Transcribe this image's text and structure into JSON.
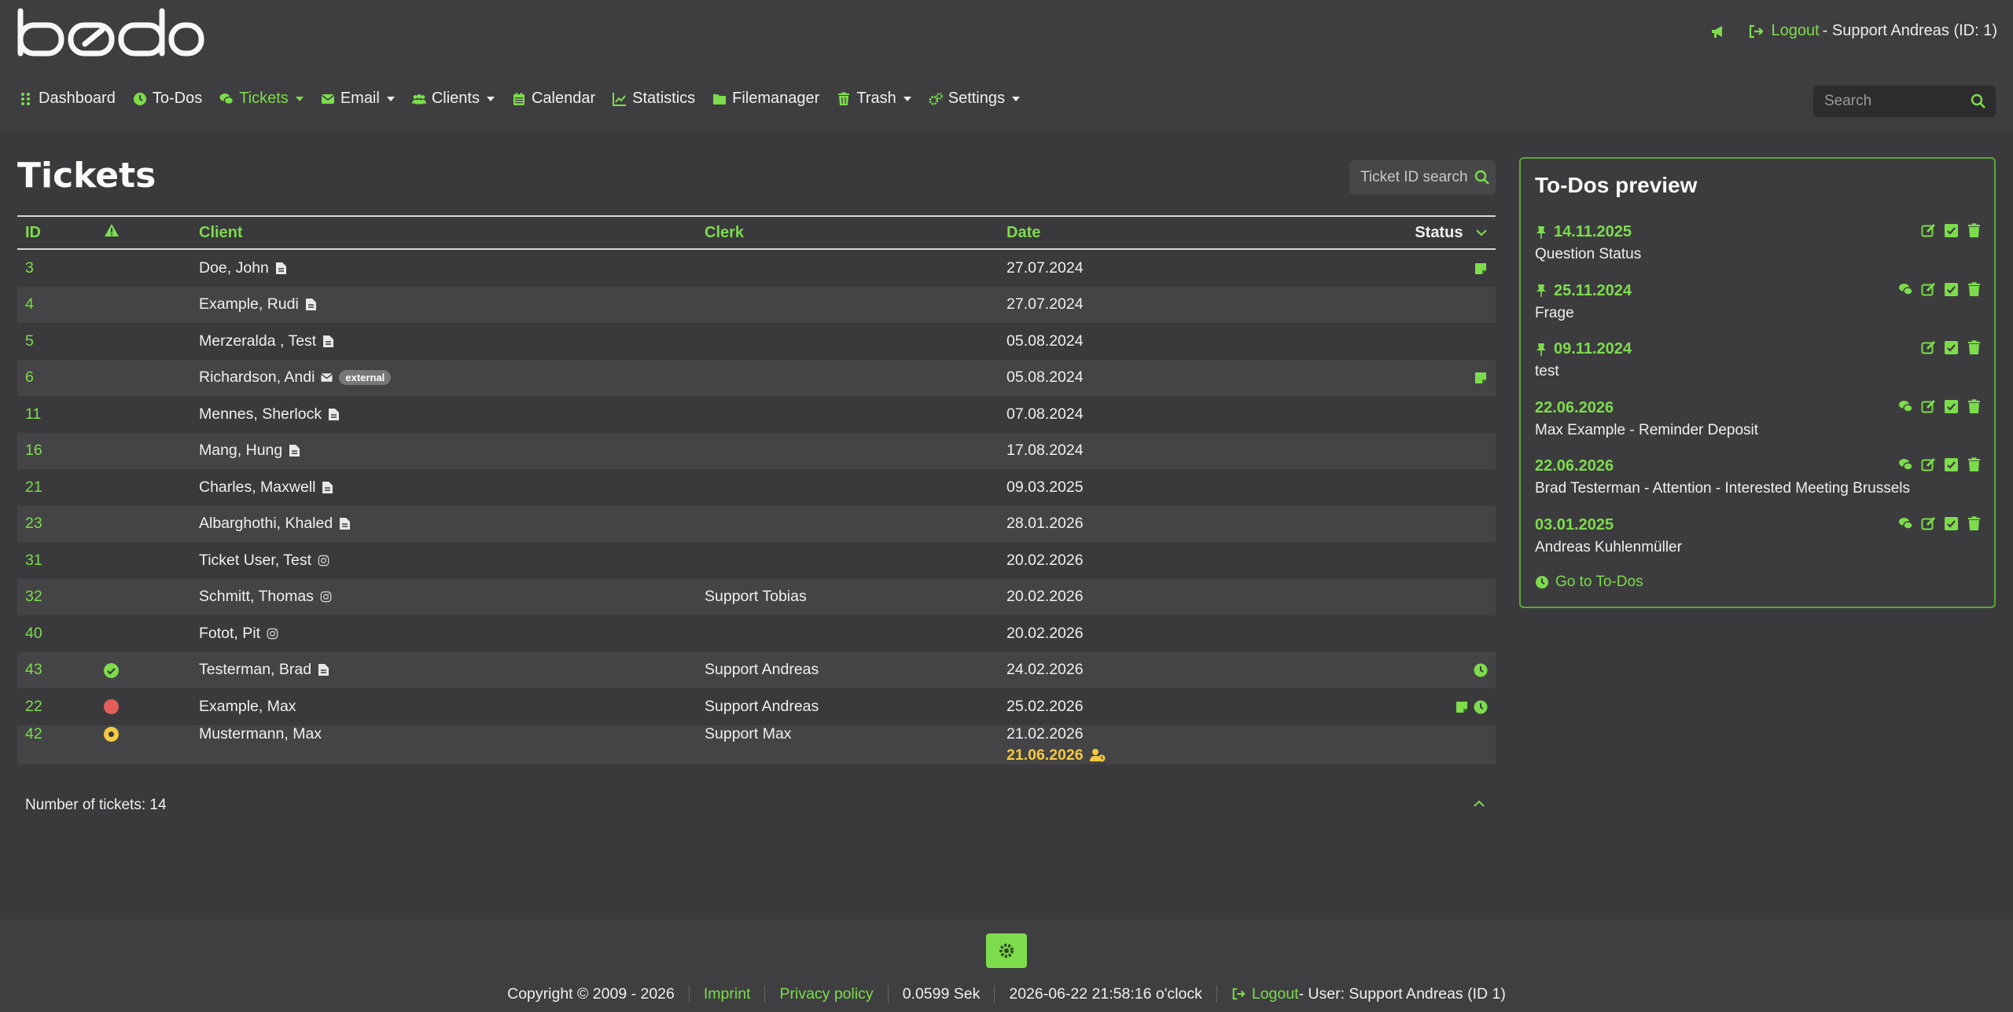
{
  "header": {
    "logo_text": "bodo",
    "logout_label": "Logout",
    "user_text": " - Support Andreas (ID: 1)",
    "search_placeholder": "Search"
  },
  "nav": [
    {
      "label": "Dashboard",
      "icon": "dashboard-icon"
    },
    {
      "label": "To-Dos",
      "icon": "clock-icon"
    },
    {
      "label": "Tickets",
      "icon": "comments-icon",
      "active": true,
      "dropdown": true
    },
    {
      "label": "Email",
      "icon": "envelope-icon",
      "dropdown": true
    },
    {
      "label": "Clients",
      "icon": "users-icon",
      "dropdown": true
    },
    {
      "label": "Calendar",
      "icon": "calendar-icon"
    },
    {
      "label": "Statistics",
      "icon": "chart-line-icon"
    },
    {
      "label": "Filemanager",
      "icon": "folder-icon"
    },
    {
      "label": "Trash",
      "icon": "trash-icon",
      "dropdown": true
    },
    {
      "label": "Settings",
      "icon": "cogs-icon",
      "dropdown": true
    }
  ],
  "main": {
    "title": "Tickets",
    "ticket_search_label": "Ticket ID search",
    "columns": {
      "id": "ID",
      "client": "Client",
      "clerk": "Clerk",
      "date": "Date",
      "status": "Status"
    },
    "rows": [
      {
        "id": "3",
        "client": "Doe, John",
        "client_icon": "file-icon",
        "clerk": "",
        "date": "27.07.2024",
        "status": [
          "note"
        ]
      },
      {
        "id": "4",
        "client": "Example, Rudi",
        "client_icon": "file-icon",
        "clerk": "",
        "date": "27.07.2024",
        "status": []
      },
      {
        "id": "5",
        "client": "Merzeralda , Test",
        "client_icon": "file-icon",
        "clerk": "",
        "date": "05.08.2024",
        "status": []
      },
      {
        "id": "6",
        "client": "Richardson, Andi",
        "client_icon": "envelope-icon",
        "badge": "external",
        "clerk": "",
        "date": "05.08.2024",
        "status": [
          "note"
        ]
      },
      {
        "id": "11",
        "client": "Mennes, Sherlock",
        "client_icon": "file-icon",
        "clerk": "",
        "date": "07.08.2024",
        "status": []
      },
      {
        "id": "16",
        "client": "Mang, Hung",
        "client_icon": "file-icon",
        "clerk": "",
        "date": "17.08.2024",
        "status": []
      },
      {
        "id": "21",
        "client": "Charles, Maxwell",
        "client_icon": "file-icon",
        "clerk": "",
        "date": "09.03.2025",
        "status": []
      },
      {
        "id": "23",
        "client": "Albarghothi, Khaled",
        "client_icon": "file-icon",
        "clerk": "",
        "date": "28.01.2026",
        "status": []
      },
      {
        "id": "31",
        "client": "Ticket User, Test",
        "client_icon": "instagram-icon",
        "clerk": "",
        "date": "20.02.2026",
        "status": []
      },
      {
        "id": "32",
        "client": "Schmitt, Thomas",
        "client_icon": "instagram-icon",
        "clerk": "Support Tobias",
        "date": "20.02.2026",
        "status": []
      },
      {
        "id": "40",
        "client": "Fotot, Pit",
        "client_icon": "instagram-icon",
        "clerk": "",
        "date": "20.02.2026",
        "status": []
      },
      {
        "id": "43",
        "priority": "done",
        "client": "Testerman, Brad",
        "client_icon": "file-icon",
        "clerk": "Support Andreas",
        "date": "24.02.2026",
        "status": [
          "clock"
        ]
      },
      {
        "id": "22",
        "priority": "high",
        "client": "Example, Max",
        "client_icon": "",
        "clerk": "Support Andreas",
        "date": "25.02.2026",
        "status": [
          "note",
          "clock"
        ]
      },
      {
        "id": "42",
        "priority": "medium",
        "client": "Mustermann, Max",
        "client_icon": "",
        "clerk": "Support Max",
        "date": "21.02.2026",
        "date2": "21.06.2026",
        "status": []
      }
    ],
    "count_text": "Number of tickets: 14"
  },
  "todos": {
    "title": "To-Dos preview",
    "items": [
      {
        "date": "14.11.2025",
        "pinned": true,
        "title": "Question Status",
        "comments": false
      },
      {
        "date": "25.11.2024",
        "pinned": true,
        "title": "Frage",
        "comments": true
      },
      {
        "date": "09.11.2024",
        "pinned": true,
        "title": "test",
        "comments": false
      },
      {
        "date": "22.06.2026",
        "pinned": false,
        "title": "Max Example - Reminder Deposit",
        "comments": true
      },
      {
        "date": "22.06.2026",
        "pinned": false,
        "title": "Brad Testerman - Attention - Interested Meeting Brussels",
        "comments": true
      },
      {
        "date": "03.01.2025",
        "pinned": false,
        "title": "Andreas Kuhlenmüller",
        "comments": true
      }
    ],
    "goto_label": "Go to To-Dos"
  },
  "footer": {
    "copyright": "Copyright © 2009 - 2026",
    "imprint": "Imprint",
    "privacy": "Privacy policy",
    "load_time": "0.0599 Sek",
    "datetime": "2026-06-22 21:58:16 o'clock",
    "logout_label": "Logout",
    "user_text": " - User: Support Andreas (ID 1)"
  },
  "colors": {
    "accent": "#7ddc4c",
    "background": "#3a3a3c",
    "priority_high": "#e35d5d",
    "priority_medium": "#f4c842",
    "warning_date": "#f4c842"
  }
}
